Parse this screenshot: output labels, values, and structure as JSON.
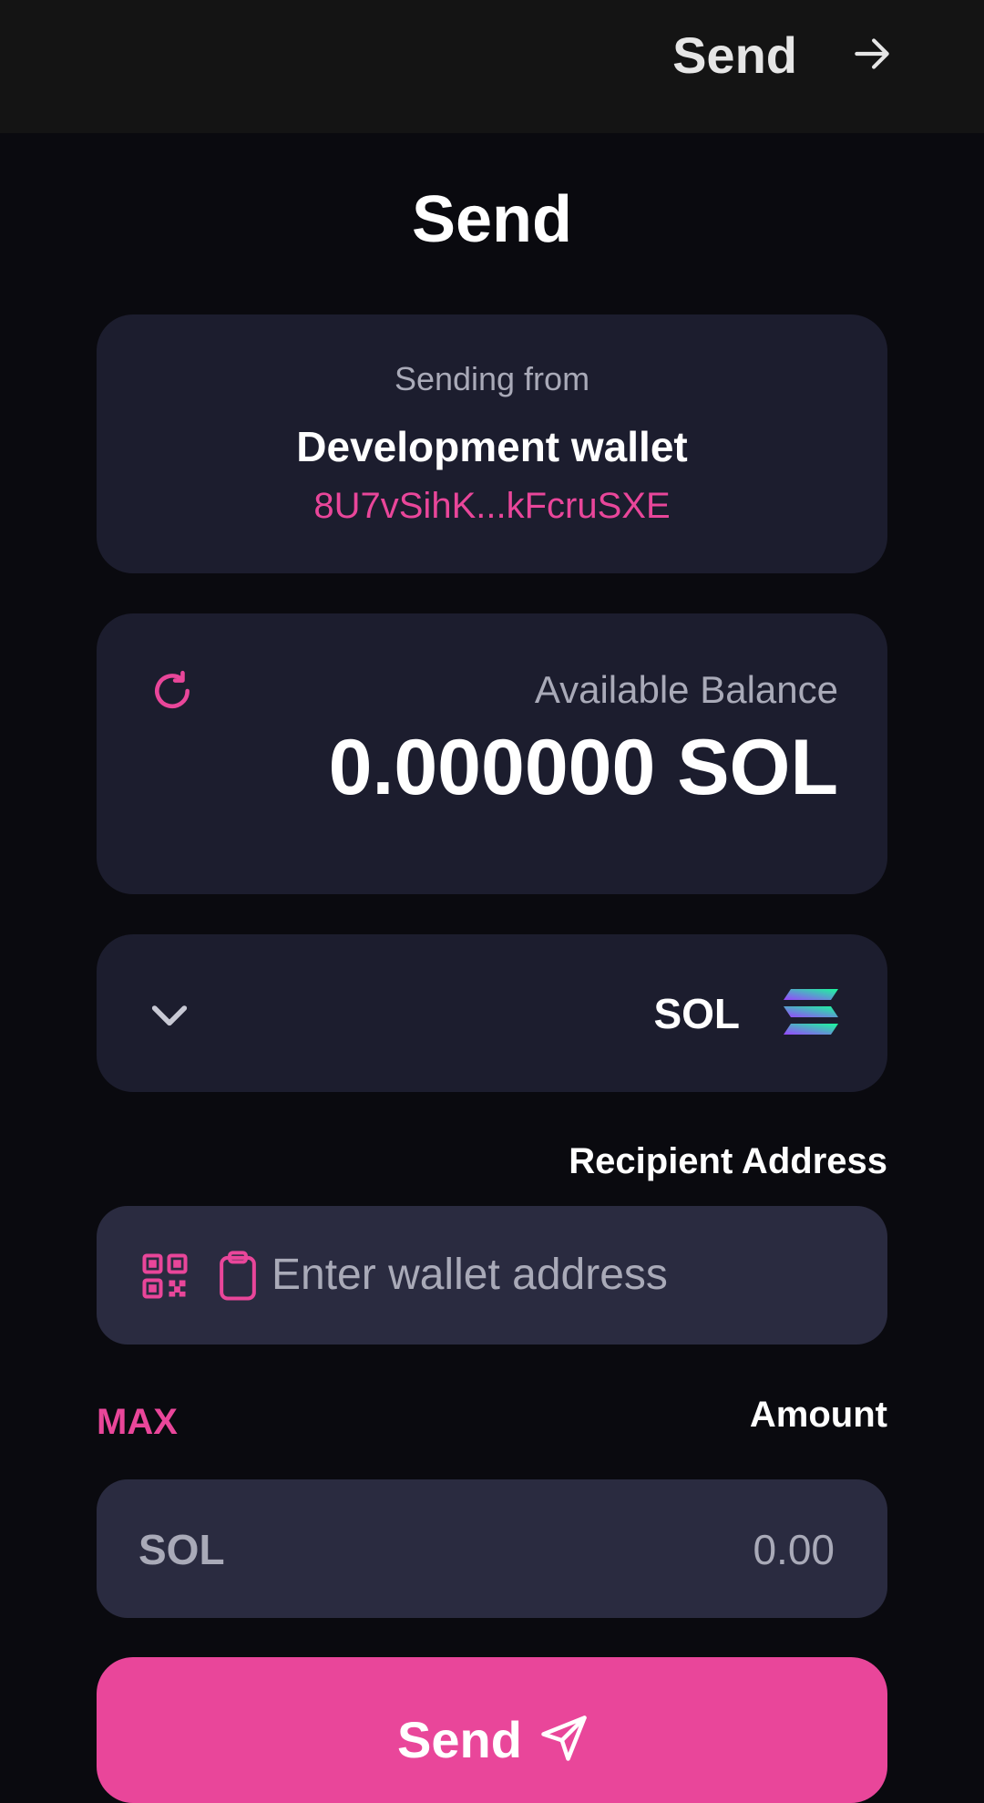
{
  "app_bar": {
    "title": "Send"
  },
  "page": {
    "title": "Send"
  },
  "sending_from": {
    "label": "Sending from",
    "wallet_name": "Development wallet",
    "address": "8U7vSihK...kFcruSXE"
  },
  "balance": {
    "label": "Available Balance",
    "value": "0.000000 SOL"
  },
  "token": {
    "symbol": "SOL"
  },
  "recipient": {
    "label": "Recipient Address",
    "placeholder": "Enter wallet address"
  },
  "amount": {
    "max_label": "MAX",
    "label": "Amount",
    "unit": "SOL",
    "placeholder": "0.00"
  },
  "send_button": {
    "label": "Send"
  },
  "colors": {
    "accent": "#e9469a",
    "background": "#0a0a0f",
    "card": "#1c1d2e",
    "input": "#2a2b40"
  }
}
